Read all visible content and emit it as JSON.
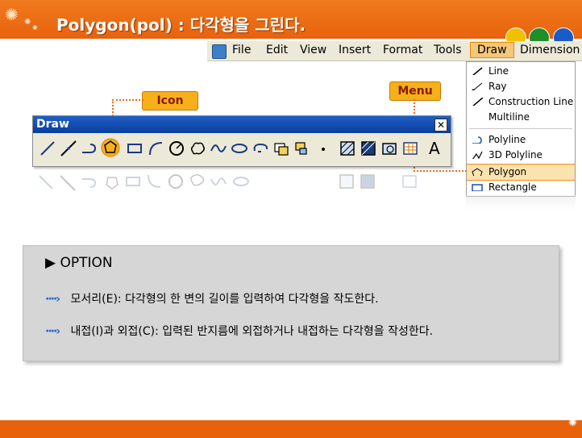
{
  "header": {
    "title": "Polygon(pol) : 다각형을 그린다."
  },
  "menubar": {
    "items": [
      "File",
      "Edit",
      "View",
      "Insert",
      "Format",
      "Tools",
      "Draw",
      "Dimension"
    ],
    "active": "Draw"
  },
  "dropdown": {
    "items": [
      {
        "label": "Line",
        "icon": "line-icon"
      },
      {
        "label": "Ray",
        "icon": "ray-icon"
      },
      {
        "label": "Construction Line",
        "icon": "construction-line-icon"
      },
      {
        "label": "Multiline",
        "icon": ""
      },
      {
        "label": "Polyline",
        "icon": "polyline-icon"
      },
      {
        "label": "3D Polyline",
        "icon": "3d-polyline-icon"
      },
      {
        "label": "Polygon",
        "icon": "polygon-icon"
      },
      {
        "label": "Rectangle",
        "icon": "rectangle-icon"
      }
    ],
    "highlighted": "Polygon"
  },
  "callouts": {
    "icon": "Icon",
    "menu": "Menu"
  },
  "toolbar": {
    "title": "Draw",
    "close": "✕",
    "text_tool": "A",
    "icons": [
      "line-icon",
      "construction-line-icon",
      "polyline-icon",
      "polygon-icon",
      "rectangle-icon",
      "arc-icon",
      "circle-icon",
      "revision-cloud-icon",
      "spline-icon",
      "ellipse-icon",
      "ellipse-arc-icon",
      "insert-block-icon",
      "make-block-icon",
      "point-icon",
      "hatch-icon",
      "gradient-icon",
      "region-icon",
      "table-icon",
      "multiline-text-icon"
    ]
  },
  "option": {
    "title": "OPTION",
    "lines": [
      "모서리(E): 다각형의 한 변의 길이를 입력하여 다각형을 작도한다.",
      "내접(I)과 외접(C): 입력된 반지름에 외접하거나 내접하는 다각형을 작성한다."
    ]
  },
  "colors": {
    "accent": "#e8620c",
    "highlight": "#fbe3b0",
    "title_bar": "#1f5fc8"
  }
}
